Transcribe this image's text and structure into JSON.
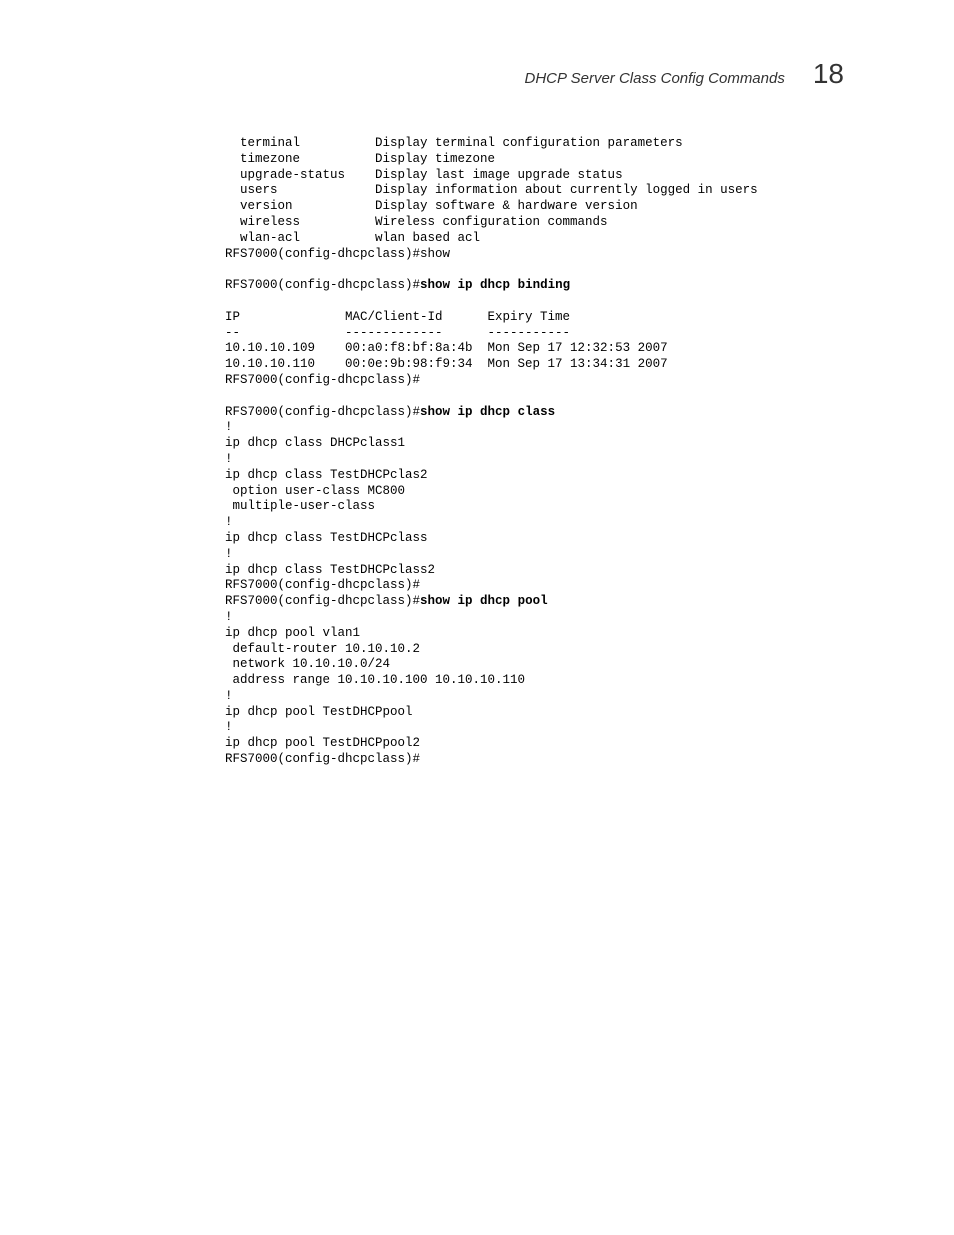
{
  "header": {
    "title": "DHCP Server Class Config Commands",
    "chapter_number": "18"
  },
  "cli": {
    "help_rows": [
      {
        "cmd": "terminal",
        "desc": "Display terminal configuration parameters"
      },
      {
        "cmd": "timezone",
        "desc": "Display timezone"
      },
      {
        "cmd": "upgrade-status",
        "desc": "Display last image upgrade status"
      },
      {
        "cmd": "users",
        "desc": "Display information about currently logged in users"
      },
      {
        "cmd": "version",
        "desc": "Display software & hardware version"
      },
      {
        "cmd": "wireless",
        "desc": "Wireless configuration commands"
      },
      {
        "cmd": "wlan-acl",
        "desc": "wlan based acl"
      }
    ],
    "prompt_show": "RFS7000(config-dhcpclass)#show",
    "prompt": "RFS7000(config-dhcpclass)#",
    "cmd_binding": "show ip dhcp binding",
    "binding_hdr_ip": "IP",
    "binding_hdr_mac": "MAC/Client-Id",
    "binding_hdr_exp": "Expiry Time",
    "binding_sep_ip": "--",
    "binding_sep_mac": "-------------",
    "binding_sep_exp": "-----------",
    "bindings": [
      {
        "ip": "10.10.10.109",
        "mac": "00:a0:f8:bf:8a:4b",
        "exp": "Mon Sep 17 12:32:53 2007"
      },
      {
        "ip": "10.10.10.110",
        "mac": "00:0e:9b:98:f9:34",
        "exp": "Mon Sep 17 13:34:31 2007"
      }
    ],
    "cmd_class": "show ip dhcp class",
    "class_lines": [
      "!",
      "ip dhcp class DHCPclass1",
      "!",
      "ip dhcp class TestDHCPclas2",
      " option user-class MC800",
      " multiple-user-class",
      "!",
      "ip dhcp class TestDHCPclass",
      "!",
      "ip dhcp class TestDHCPclass2",
      "RFS7000(config-dhcpclass)#"
    ],
    "cmd_pool": "show ip dhcp pool",
    "pool_lines": [
      "!",
      "ip dhcp pool vlan1",
      " default-router 10.10.10.2",
      " network 10.10.10.0/24",
      " address range 10.10.10.100 10.10.10.110",
      "!",
      "ip dhcp pool TestDHCPpool",
      "!",
      "ip dhcp pool TestDHCPpool2",
      "RFS7000(config-dhcpclass)#"
    ]
  }
}
